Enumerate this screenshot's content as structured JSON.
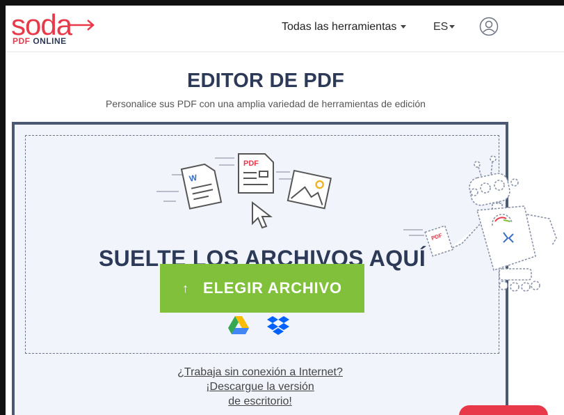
{
  "header": {
    "logo_text": "soda",
    "logo_sub_pdf": "PDF",
    "logo_sub_online": " ONLINE",
    "tools_menu": "Todas las herramientas",
    "language": "ES",
    "user_icon": "user-icon"
  },
  "main": {
    "title": "EDITOR DE PDF",
    "subtitle": "Personalice sus PDF con una amplia variedad de herramientas de edición",
    "drop_text": "SUELTE LOS ARCHIVOS AQUÍ",
    "choose_button": "ELEGIR ARCHIVO",
    "pdf_doc_label": "PDF",
    "word_doc_label": "W",
    "cloud_sources": [
      "google-drive-icon",
      "dropbox-icon"
    ],
    "offline_line1": "¿Trabaja sin conexión a Internet?",
    "offline_line2": "¡Descargue la versión",
    "offline_line3": "de escritorio!"
  },
  "colors": {
    "brand_red": "#e8394a",
    "navy": "#2d3a57",
    "green": "#80c03b"
  }
}
